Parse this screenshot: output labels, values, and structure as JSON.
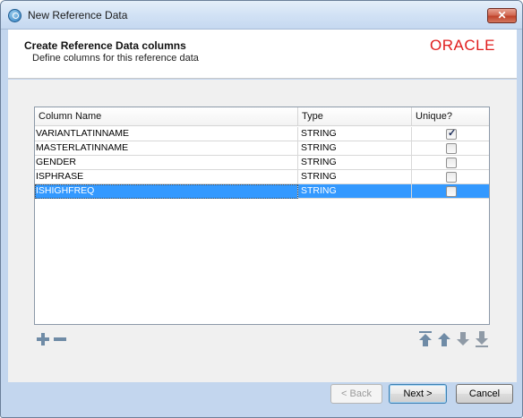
{
  "window": {
    "title": "New Reference Data",
    "close_label": "✕"
  },
  "header": {
    "title": "Create Reference Data columns",
    "subtitle": "Define columns for this reference data",
    "logo_text": "ORACLE"
  },
  "table": {
    "columns": [
      "Column Name",
      "Type",
      "Unique?"
    ],
    "rows": [
      {
        "name": "VARIANTLATINNAME",
        "type": "STRING",
        "unique": true
      },
      {
        "name": "MASTERLATINNAME",
        "type": "STRING",
        "unique": false
      },
      {
        "name": "GENDER",
        "type": "STRING",
        "unique": false
      },
      {
        "name": "ISPHRASE",
        "type": "STRING",
        "unique": false
      },
      {
        "name": "ISHIGHFREQ",
        "type": "STRING",
        "unique": false,
        "selected": true
      }
    ]
  },
  "toolbar": {
    "add_icon": "plus-icon",
    "remove_icon": "minus-icon",
    "move_top_icon": "arrow-top-icon",
    "move_up_icon": "arrow-up-icon",
    "move_down_icon": "arrow-down-icon",
    "move_bottom_icon": "arrow-bottom-icon"
  },
  "buttons": {
    "back": "< Back",
    "next": "Next >",
    "cancel": "Cancel"
  },
  "colors": {
    "selection": "#3399ff",
    "oracle_red": "#e01d1d",
    "icon_blue": "#6f8ba6"
  }
}
